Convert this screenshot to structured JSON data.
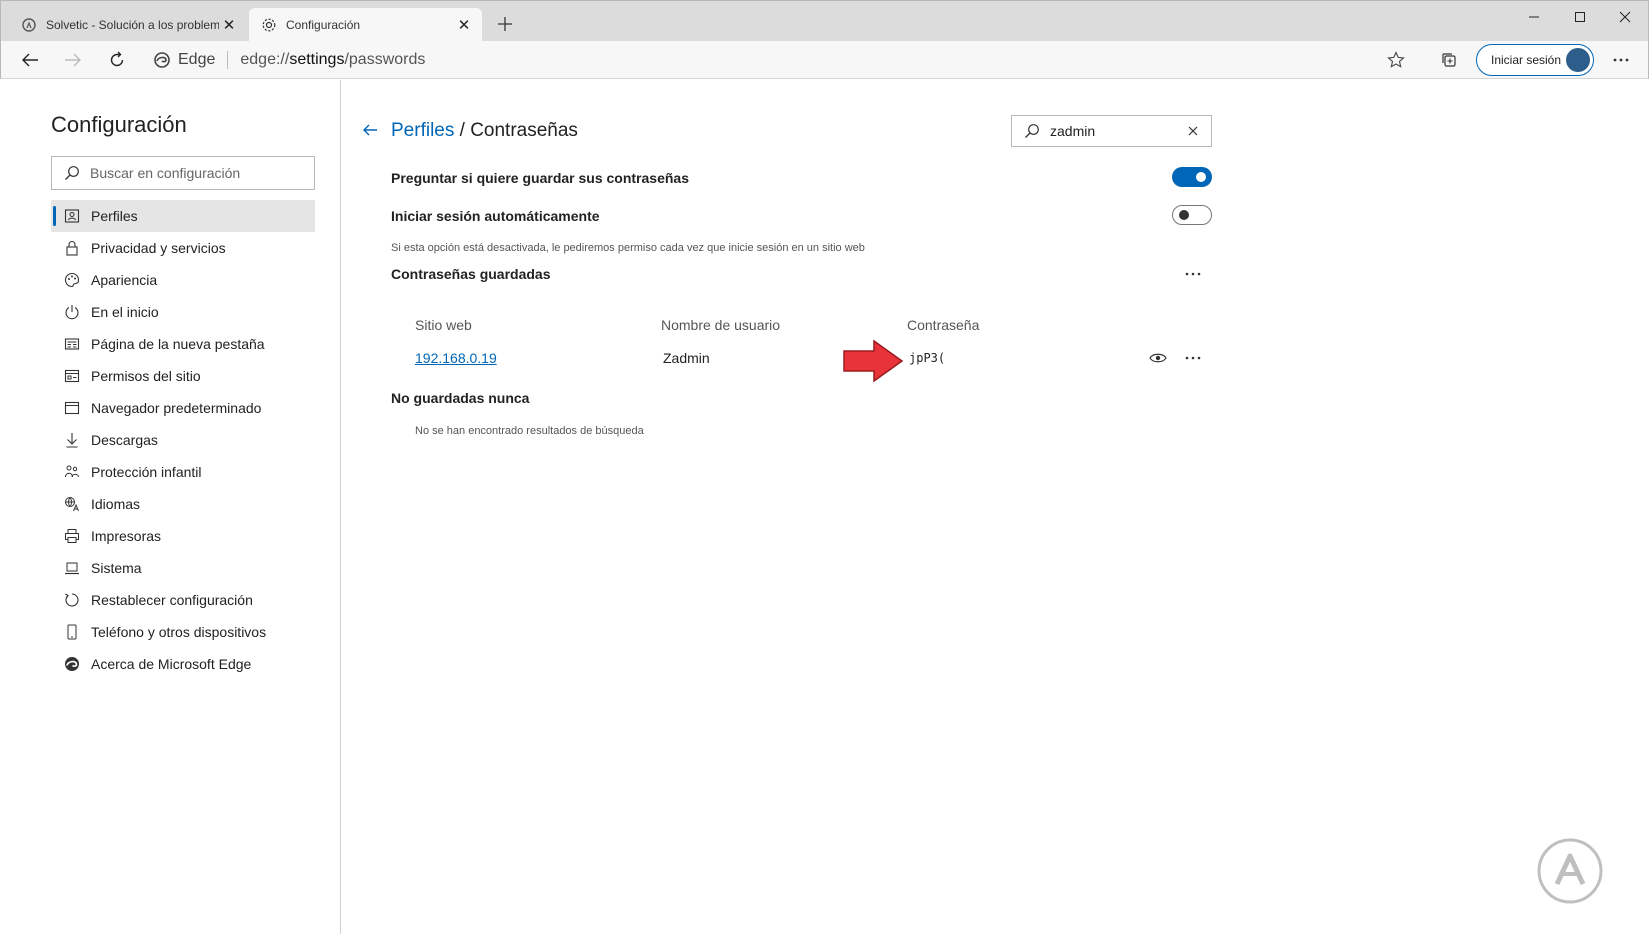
{
  "tabs": [
    {
      "label": "Solvetic - Solución a los problem",
      "icon": "solvetic-icon",
      "active": false
    },
    {
      "label": "Configuración",
      "icon": "gear-icon",
      "active": true
    }
  ],
  "address_bar": {
    "site_name": "Edge",
    "url_prefix": "edge://",
    "url_host": "settings",
    "url_path": "/passwords"
  },
  "signin": {
    "label": "Iniciar sesión"
  },
  "sidebar": {
    "title": "Configuración",
    "search_placeholder": "Buscar en configuración",
    "items": [
      {
        "label": "Perfiles",
        "icon": "profile-icon",
        "selected": true
      },
      {
        "label": "Privacidad y servicios",
        "icon": "lock-icon"
      },
      {
        "label": "Apariencia",
        "icon": "palette-icon"
      },
      {
        "label": "En el inicio",
        "icon": "power-icon"
      },
      {
        "label": "Página de la nueva pestaña",
        "icon": "newtab-icon"
      },
      {
        "label": "Permisos del sitio",
        "icon": "site-permissions-icon"
      },
      {
        "label": "Navegador predeterminado",
        "icon": "browser-icon"
      },
      {
        "label": "Descargas",
        "icon": "download-icon"
      },
      {
        "label": "Protección infantil",
        "icon": "family-icon"
      },
      {
        "label": "Idiomas",
        "icon": "language-icon"
      },
      {
        "label": "Impresoras",
        "icon": "printer-icon"
      },
      {
        "label": "Sistema",
        "icon": "laptop-icon"
      },
      {
        "label": "Restablecer configuración",
        "icon": "reset-icon"
      },
      {
        "label": "Teléfono y otros dispositivos",
        "icon": "phone-icon"
      },
      {
        "label": "Acerca de Microsoft Edge",
        "icon": "edge-logo-icon"
      }
    ]
  },
  "main": {
    "breadcrumb_link": "Perfiles",
    "breadcrumb_sep": " / ",
    "breadcrumb_current": "Contraseñas",
    "search_value": "zadmin",
    "offer_save": {
      "label": "Preguntar si quiere guardar sus contraseñas",
      "on": true
    },
    "auto_signin": {
      "label": "Iniciar sesión automáticamente",
      "on": false,
      "description": "Si esta opción está desactivada, le pediremos permiso cada vez que inicie sesión en un sitio web"
    },
    "saved": {
      "title": "Contraseñas guardadas",
      "columns": [
        "Sitio web",
        "Nombre de usuario",
        "Contraseña"
      ],
      "rows": [
        {
          "site": "192.168.0.19",
          "username": "Zadmin",
          "password": "jpP3("
        }
      ]
    },
    "never": {
      "title": "No guardadas nunca",
      "empty_text": "No se han encontrado resultados de búsqueda"
    }
  },
  "colors": {
    "accent": "#0067b8",
    "arrow": "#e8333a"
  }
}
